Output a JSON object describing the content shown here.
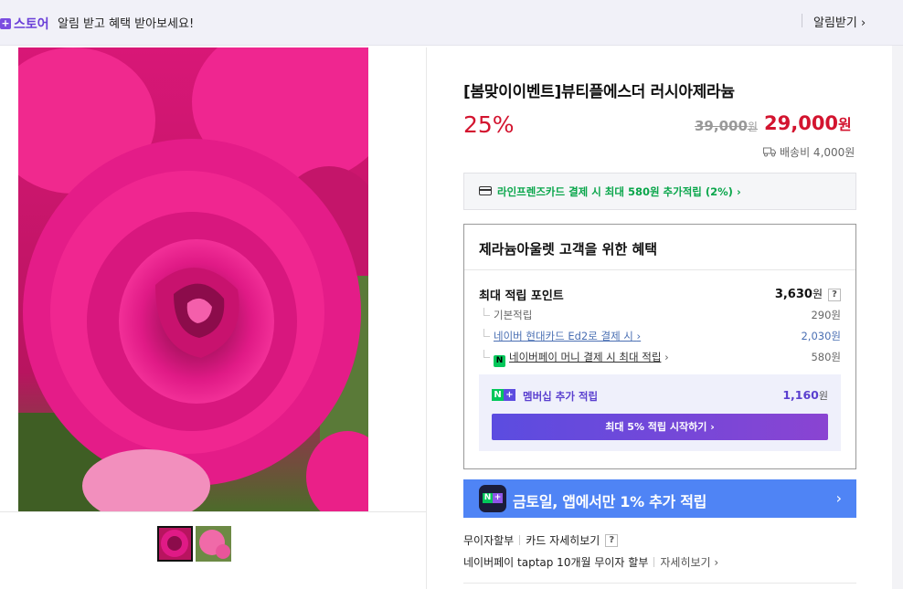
{
  "topbar": {
    "store_label": "스토어",
    "message": "알림 받고 혜택 받아보세요!",
    "alarm_button": "알림받기"
  },
  "product": {
    "title": "[봄맞이이벤트]뷰티플에스더 러시아제라늄",
    "discount": "25%",
    "original_price": "39,000",
    "original_unit": "원",
    "price": "29,000",
    "price_unit": "원",
    "shipping": "배송비 4,000원",
    "thumbnails": [
      "thumb-1",
      "thumb-2"
    ]
  },
  "card_offer": {
    "text": "라인프렌즈카드 결제 시 최대 580원 추가적립 (2%)"
  },
  "benefit": {
    "title": "제라늄아울렛 고객을 위한 혜택",
    "max_points_label": "최대 적립 포인트",
    "max_points_value": "3,630",
    "max_points_unit": "원",
    "rows": [
      {
        "label": "기본적립",
        "value": "290원"
      },
      {
        "label": "네이버 현대카드 Ed2로 결제 시",
        "value": "2,030원"
      },
      {
        "label": "네이버페이 머니 결제 시 최대 적립",
        "value": "580원"
      }
    ],
    "membership_label": "멤버십 추가 적립",
    "membership_value": "1,160",
    "membership_unit": "원",
    "membership_button": "최대 5% 적립 시작하기"
  },
  "app_banner": {
    "text": "금토일, 앱에서만 1% 추가 적립"
  },
  "payment_info": {
    "installment": "무이자할부",
    "card_detail": "카드 자세히보기",
    "taptap": "네이버페이 taptap 10개월 무이자 할부",
    "detail": "자세히보기"
  },
  "colors": {
    "accent_red": "#d3142f",
    "naver_green": "#03c75a",
    "purple": "#5b4ce0",
    "banner_blue": "#4f84f5"
  }
}
